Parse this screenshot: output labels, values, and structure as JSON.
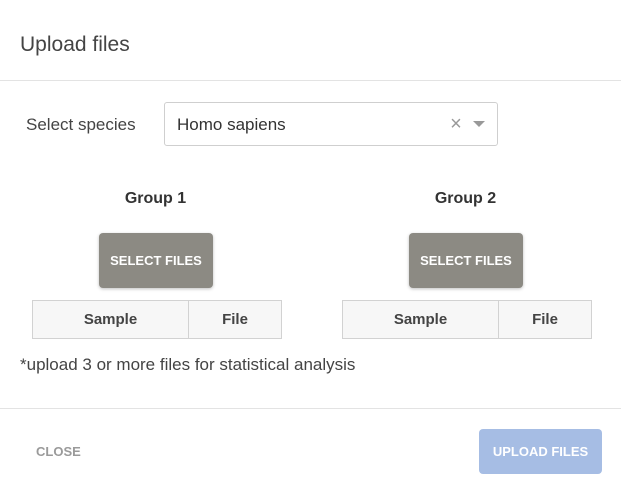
{
  "dialog": {
    "title": "Upload files"
  },
  "species": {
    "label": "Select species",
    "value": "Homo sapiens",
    "clear_icon": "close-icon",
    "dropdown_icon": "chevron-down-icon"
  },
  "groups": [
    {
      "title": "Group 1",
      "button_label": "SELECT FILES",
      "columns": [
        "Sample",
        "File"
      ],
      "rows": []
    },
    {
      "title": "Group 2",
      "button_label": "SELECT FILES",
      "columns": [
        "Sample",
        "File"
      ],
      "rows": []
    }
  ],
  "note": "*upload 3 or more files for statistical analysis",
  "footer": {
    "close_label": "CLOSE",
    "upload_label": "UPLOAD FILES"
  },
  "colors": {
    "select_button": "#8c8a83",
    "upload_button": "#a6bde4",
    "close_text": "#9a9a9a"
  }
}
